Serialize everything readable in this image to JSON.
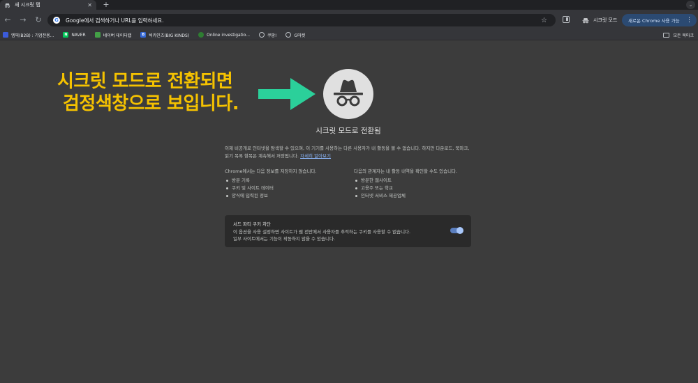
{
  "tab": {
    "title": "새 시크릿 탭",
    "close": "✕",
    "new_tab": "+",
    "menu": "⌄"
  },
  "toolbar": {
    "back": "←",
    "forward": "→",
    "reload": "↻",
    "omnibox_placeholder": "Google에서 검색하거나 URL을 입력하세요.",
    "bookmark_star": "☆",
    "incognito_label": "시크릿 모드",
    "update_label": "새로운 Chrome 사용 가능",
    "menu": "⋮"
  },
  "bookmarks": {
    "items": [
      {
        "label": "엠픽(B2B) : 기업전용...",
        "icon_color": "#3b5bdb",
        "icon_text": ""
      },
      {
        "label": "NAVER",
        "icon_color": "#03c75a",
        "icon_text": "N"
      },
      {
        "label": "네이버 데이터랩",
        "icon_color": "#43a047",
        "icon_text": ""
      },
      {
        "label": "빅카인즈(BIG KINDS)",
        "icon_color": "#3367d6",
        "icon_text": "B"
      },
      {
        "label": "Online investigatio...",
        "icon_color": "#2e7d32",
        "icon_text": ""
      },
      {
        "label": "쿠팡!",
        "icon_color": "",
        "icon_text": ""
      },
      {
        "label": "G마켓",
        "icon_color": "",
        "icon_text": ""
      }
    ],
    "all_bookmarks": "모든 북마크"
  },
  "annotation": {
    "line1": "시크릿 모드로 전환되면",
    "line2": "검정색창으로 보입니다.",
    "color": "#f5c200",
    "arrow_color": "#2bd09a"
  },
  "ntp": {
    "title": "시크릿 모드로 전환됨",
    "intro": "이제 비공개로 인터넷을 탐색할 수 있으며, 이 기기를 사용하는 다른 사용자가 내 활동을 볼 수 없습니다. 하지만 다운로드, 북마크, 읽기 목록 항목은 계속해서 저장됩니다.",
    "learn_more": "자세히 알아보기",
    "left_heading": "Chrome에서는 다음 정보를 저장하지 않습니다.",
    "left_items": [
      "방문 기록",
      "쿠키 및 사이트 데이터",
      "양식에 입력된 정보"
    ],
    "right_heading": "다음의 관계자는 내 활동 내역을 확인할 수도 있습니다.",
    "right_items": [
      "방문한 웹사이트",
      "고용주 또는 학교",
      "인터넷 서비스 제공업체"
    ],
    "cookie_title": "서드 파티 쿠키 차단",
    "cookie_line1": "이 옵션을 사용 설정하면 사이트가 웹 전반에서 사용자를 추적하는 쿠키를 사용할 수 없습니다.",
    "cookie_line2": "일부 사이트에서는 기능이 작동하지 않을 수 있습니다.",
    "cookie_toggle_on": true
  }
}
